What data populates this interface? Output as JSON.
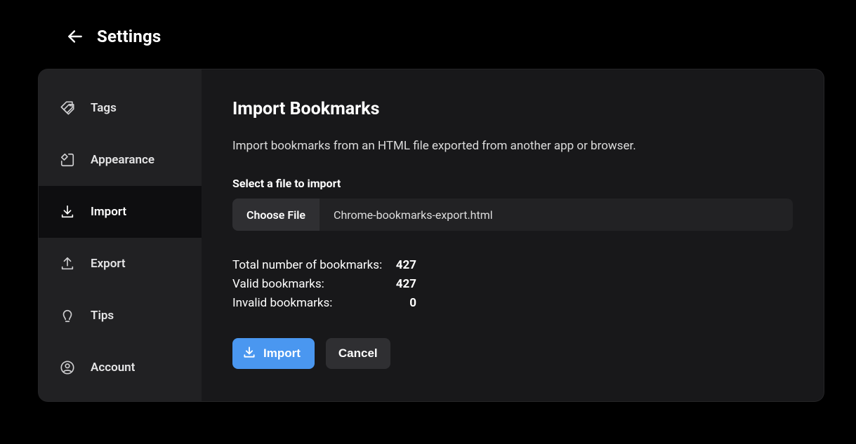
{
  "header": {
    "title": "Settings"
  },
  "sidebar": {
    "items": [
      {
        "label": "Tags"
      },
      {
        "label": "Appearance"
      },
      {
        "label": "Import"
      },
      {
        "label": "Export"
      },
      {
        "label": "Tips"
      },
      {
        "label": "Account"
      }
    ]
  },
  "main": {
    "title": "Import Bookmarks",
    "description": "Import bookmarks from an HTML file exported from another app or browser.",
    "select_label": "Select a file to import",
    "choose_file_label": "Choose File",
    "selected_file": "Chrome-bookmarks-export.html",
    "stats": {
      "total_label": "Total number of bookmarks:",
      "total_value": "427",
      "valid_label": "Valid bookmarks:",
      "valid_value": "427",
      "invalid_label": "Invalid bookmarks:",
      "invalid_value": "0"
    },
    "import_button": "Import",
    "cancel_button": "Cancel"
  }
}
